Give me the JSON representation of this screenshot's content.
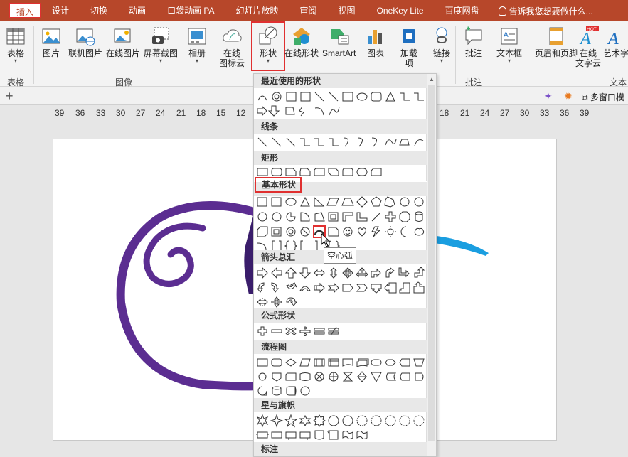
{
  "tabs": [
    "插入",
    "设计",
    "切换",
    "动画",
    "口袋动画 PA",
    "幻灯片放映",
    "审阅",
    "视图",
    "OneKey Lite",
    "百度网盘"
  ],
  "tell_me": "告诉我您想要做什么...",
  "ribbon": {
    "table": {
      "label": "表格",
      "group": "表格"
    },
    "picture": "图片",
    "online_picture": "联机图片",
    "online_picture2": "在线图片",
    "screenshot": "屏幕截图",
    "album": "相册",
    "images_group": "图像",
    "online_icon_cloud": [
      "在线",
      "图标云"
    ],
    "shapes": "形状",
    "online_shapes": "在线形状",
    "smartart": "SmartArt",
    "chart": "图表",
    "addins": [
      "加载",
      "项"
    ],
    "link": "链接",
    "comment": "批注",
    "comment_group": "批注",
    "textbox": "文本框",
    "header_footer": "页眉和页脚",
    "online_text_cloud": [
      "在线",
      "文字云"
    ],
    "wordart": "艺术字",
    "text_group": "文本",
    "hot_badge": "HOT"
  },
  "subbar": {
    "multi_window": "多窗口模"
  },
  "ruler": [
    "39",
    "36",
    "33",
    "30",
    "27",
    "24",
    "21",
    "18",
    "15",
    "12",
    "18",
    "21",
    "24",
    "27",
    "30",
    "33",
    "36",
    "39"
  ],
  "dropdown": {
    "sections": [
      "最近使用的形状",
      "线条",
      "矩形",
      "基本形状",
      "箭头总汇",
      "公式形状",
      "流程图",
      "星与旗帜",
      "标注"
    ]
  },
  "tooltip": "空心弧",
  "colors": {
    "accent": "#b7472a",
    "highlight": "#e03030",
    "spiral": "#5b2d91",
    "blue": "#1a9ee0"
  }
}
